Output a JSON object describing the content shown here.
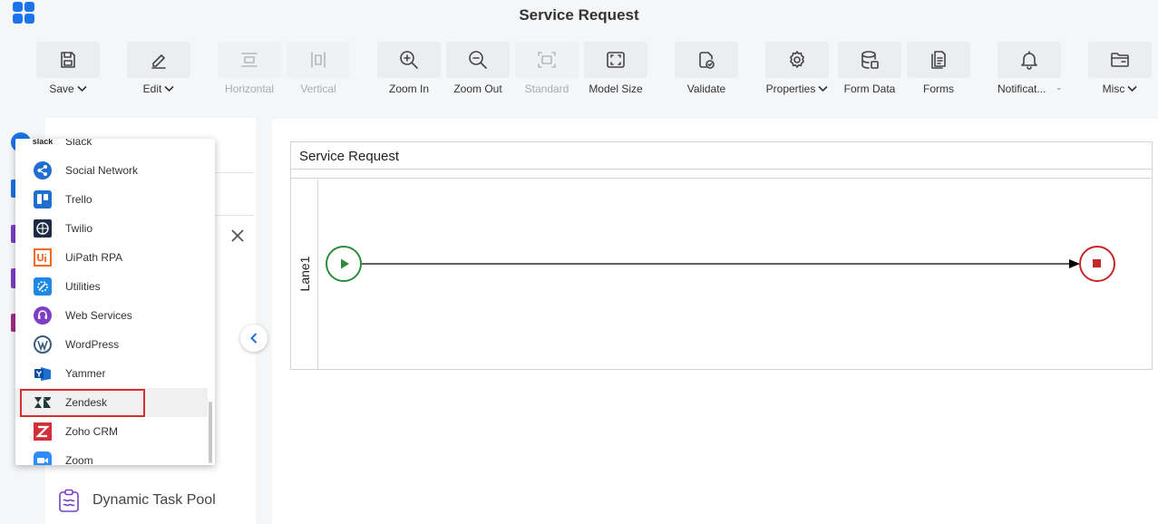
{
  "window": {
    "title": "Service Request"
  },
  "toolbar": {
    "buttons": [
      {
        "label": "Save",
        "icon": "save-icon",
        "dropdown": true
      },
      {
        "label": "Edit",
        "icon": "pencil-icon",
        "dropdown": true
      },
      {
        "label": "Horizontal",
        "icon": "horizontal-layout-icon",
        "disabled": true
      },
      {
        "label": "Vertical",
        "icon": "vertical-layout-icon",
        "disabled": true
      },
      {
        "label": "Zoom In",
        "icon": "zoom-in-icon"
      },
      {
        "label": "Zoom Out",
        "icon": "zoom-out-icon"
      },
      {
        "label": "Standard",
        "icon": "standard-size-icon",
        "disabled": true
      },
      {
        "label": "Model Size",
        "icon": "model-size-icon"
      },
      {
        "label": "Validate",
        "icon": "validate-icon"
      },
      {
        "label": "Properties",
        "icon": "gear-icon",
        "dropdown": true
      },
      {
        "label": "Form Data",
        "icon": "database-icon"
      },
      {
        "label": "Forms",
        "icon": "forms-icon"
      },
      {
        "label": "Notificat...",
        "icon": "bell-icon",
        "dropdown": true
      },
      {
        "label": "Misc",
        "icon": "folder-icon",
        "dropdown": true
      }
    ]
  },
  "panel": {
    "dynamic_task_pool": "Dynamic Task Pool"
  },
  "menu": {
    "items": [
      {
        "label": "Slack",
        "icon": "slack-icon"
      },
      {
        "label": "Social Network",
        "icon": "share-icon"
      },
      {
        "label": "Trello",
        "icon": "trello-icon"
      },
      {
        "label": "Twilio",
        "icon": "twilio-icon"
      },
      {
        "label": "UiPath RPA",
        "icon": "uipath-icon"
      },
      {
        "label": "Utilities",
        "icon": "utilities-icon"
      },
      {
        "label": "Web Services",
        "icon": "web-services-icon"
      },
      {
        "label": "WordPress",
        "icon": "wordpress-icon"
      },
      {
        "label": "Yammer",
        "icon": "yammer-icon"
      },
      {
        "label": "Zendesk",
        "icon": "zendesk-icon",
        "selected": true
      },
      {
        "label": "Zoho CRM",
        "icon": "zoho-crm-icon"
      },
      {
        "label": "Zoom",
        "icon": "zoom-icon"
      }
    ],
    "slack_logo_text": "slack"
  },
  "canvas": {
    "pool_title": "Service Request",
    "lane_label": "Lane1"
  },
  "colors": {
    "accent": "#1a73e8",
    "start_event": "#2e8b3e",
    "end_event": "#c62828",
    "selection_border": "#d32f2f"
  }
}
